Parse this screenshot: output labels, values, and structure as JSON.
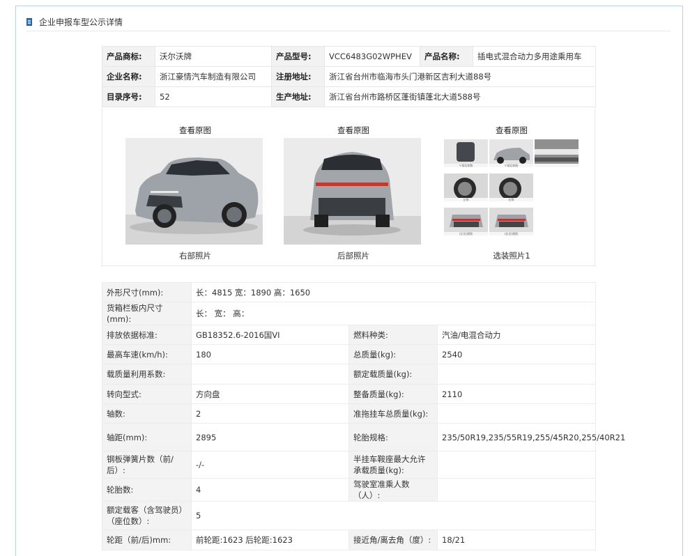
{
  "header": {
    "title": "企业申报车型公示详情",
    "icon": "document-icon"
  },
  "info": {
    "rows": [
      [
        {
          "label": "产品商标:",
          "value": "沃尔沃牌"
        },
        {
          "label": "产品型号:",
          "value": "VCC6483G02WPHEV"
        },
        {
          "label": "产品名称:",
          "value": "插电式混合动力多用途乘用车"
        }
      ],
      [
        {
          "label": "企业名称:",
          "value": "浙江豪情汽车制造有限公司"
        },
        {
          "label": "注册地址:",
          "value": "浙江省台州市临海市头门港新区吉利大道88号"
        }
      ],
      [
        {
          "label": "目录序号:",
          "value": "52"
        },
        {
          "label": "生产地址:",
          "value": "浙江省台州市路桥区蓬街镇蓬北大道588号"
        }
      ]
    ]
  },
  "photos": {
    "view_original": "查看原图",
    "items": [
      {
        "caption": "右部照片"
      },
      {
        "caption": "后部照片"
      },
      {
        "caption": "选装照片1",
        "thumb_captions": [
          "Ｖ前后轮胎",
          "Ｖ前后轮胎",
          "",
          "左侧",
          "右侧",
          "",
          "(左)后视照",
          "(右)后视照"
        ]
      }
    ]
  },
  "specs": {
    "rows": [
      {
        "type": "full",
        "label": "外形尺寸(mm):",
        "value": "长：4815 宽：1890 高：1650"
      },
      {
        "type": "full",
        "label": "货箱栏板内尺寸(mm):",
        "value": "长：  宽：  高："
      },
      {
        "type": "pair",
        "label1": "排放依据标准:",
        "value1": "GB18352.6-2016国VI",
        "label2": "燃料种类:",
        "value2": "汽油/电混合动力"
      },
      {
        "type": "pair",
        "label1": "最高车速(km/h):",
        "value1": "180",
        "label2": "总质量(kg):",
        "value2": "2540"
      },
      {
        "type": "pair",
        "label1": "载质量利用系数:",
        "value1": "",
        "label2": "额定载质量(kg):",
        "value2": ""
      },
      {
        "type": "pair",
        "label1": "转向型式:",
        "value1": "方向盘",
        "label2": "整备质量(kg):",
        "value2": "2110"
      },
      {
        "type": "pair",
        "label1": "轴数:",
        "value1": "2",
        "label2": "准拖挂车总质量(kg):",
        "value2": ""
      },
      {
        "type": "pair",
        "label1": "轴距(mm):",
        "value1": "2895",
        "label2": "轮胎规格:",
        "value2": "235/50R19,235/55R19,255/45R20,255/40R21"
      },
      {
        "type": "pair",
        "label1": "钢板弹簧片数（前/后）:",
        "value1": "-/-",
        "label2": "半挂车鞍座最大允许承载质量(kg):",
        "value2": ""
      },
      {
        "type": "pair",
        "label1": "轮胎数:",
        "value1": "4",
        "label2": "驾驶室准乘人数（人）:",
        "value2": ""
      },
      {
        "type": "full",
        "label": "额定载客（含驾驶员）（座位数）:",
        "value": "5"
      },
      {
        "type": "pair",
        "label1": "轮距（前/后)mm:",
        "value1": "前轮距:1623 后轮距:1623",
        "label2": "接近角/离去角（度）:",
        "value2": "18/21"
      }
    ]
  }
}
